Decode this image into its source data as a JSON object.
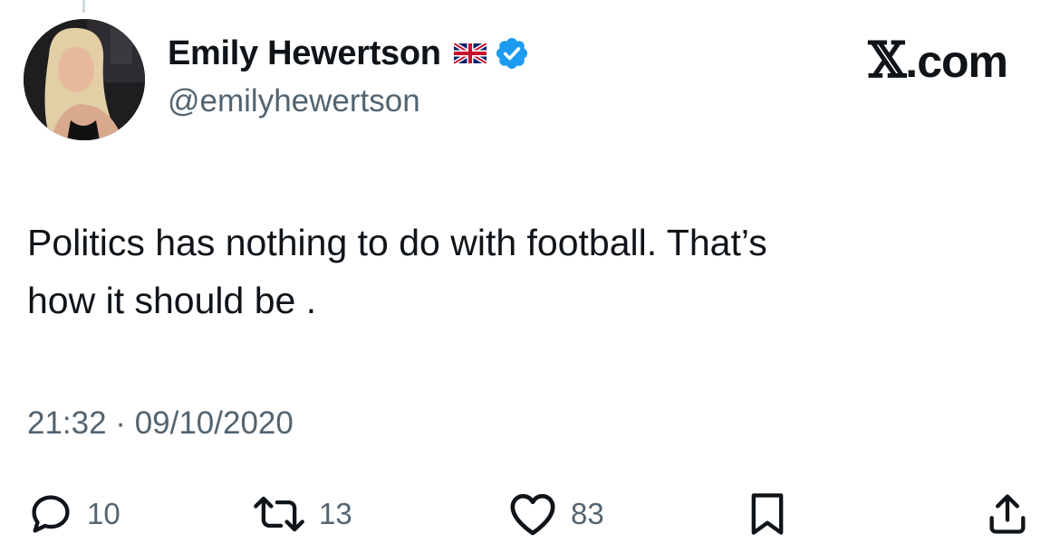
{
  "user": {
    "display_name": "Emily Hewertson",
    "handle": "@emilyhewertson",
    "flag_icon": "uk-flag-icon",
    "verified_icon": "verified-badge-icon",
    "verified_color": "#1d9bf0"
  },
  "source": {
    "logo_icon": "x-logo-icon",
    "label_letter": "𝕏",
    "label_rest": ".com"
  },
  "tweet": {
    "text_line1": "Politics has nothing to do with football. That’s",
    "text_line2": "how it should be .",
    "timestamp": "21:32 · 09/10/2020"
  },
  "actions": {
    "replies": "10",
    "reposts": "13",
    "likes": "83"
  },
  "colors": {
    "text": "#0f1419",
    "secondary": "#536471",
    "accent": "#1d9bf0"
  }
}
